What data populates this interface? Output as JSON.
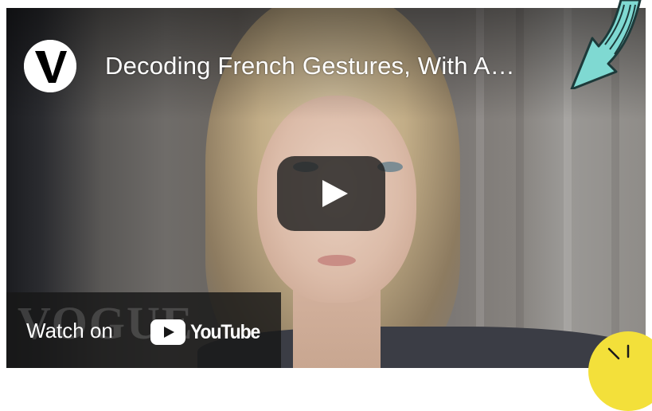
{
  "video": {
    "title": "Decoding French Gestures, With A…",
    "channel_icon": "vogue-v-logo-icon",
    "watermark": "VOGUE"
  },
  "player": {
    "play_icon": "play-icon",
    "watch_on_label": "Watch on",
    "youtube_label": "YouTube",
    "youtube_icon": "youtube-logo-icon"
  },
  "decorations": {
    "arrow_icon": "curved-arrow-icon",
    "arrow_color": "#7fd9d2",
    "badge_color": "#f3e03a"
  }
}
